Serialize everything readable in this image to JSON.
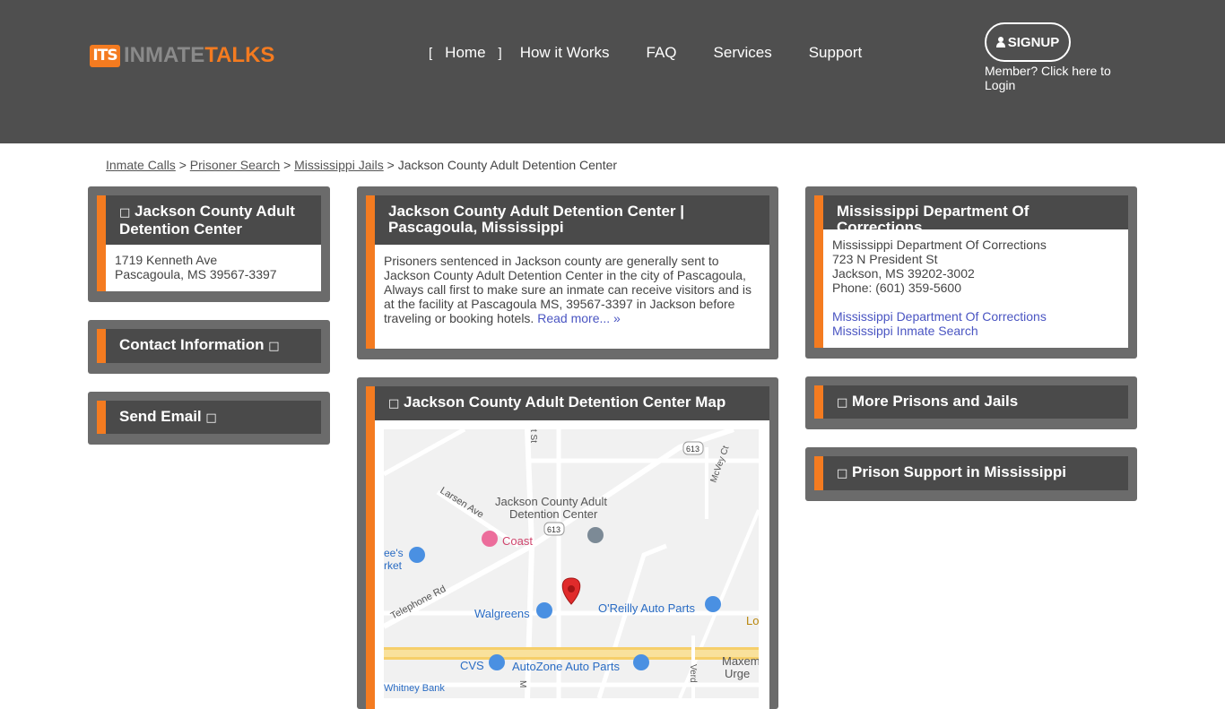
{
  "logo": {
    "badge": "ITS",
    "word1": "INMATE",
    "word2": "TALKS"
  },
  "nav": {
    "bracket_left": "[",
    "bracket_right": "]",
    "items": [
      "Home",
      "How it Works",
      "FAQ",
      "Services",
      "Support"
    ]
  },
  "header": {
    "signup_label": "SIGNUP",
    "member_text": "Member? Click here to Login"
  },
  "breadcrumb": {
    "items": [
      "Inmate Calls",
      "Prisoner Search",
      "Mississippi Jails"
    ],
    "separator": ">",
    "current": "Jackson County Adult Detention Center"
  },
  "left": {
    "facility_title": "Jackson County Adult Detention Center",
    "address_line1": "1719 Kenneth Ave",
    "address_line2": "Pascagoula, MS 39567-3397",
    "contact_title": "Contact Information",
    "email_title": "Send Email",
    "glyph": "□"
  },
  "center": {
    "title": "Jackson County Adult Detention Center | Pascagoula, Mississippi",
    "description": "Prisoners sentenced in Jackson county are generally sent to Jackson County Adult Detention Center in the city of Pascagoula, Always call first to make sure an inmate can receive visitors and is at the facility at Pascagoula MS, 39567-3397 in Jackson before traveling or booking hotels.",
    "read_more": "Read more... »",
    "map_title": "Jackson County Adult Detention Center Map"
  },
  "map": {
    "labels": {
      "facility_line1": "Jackson County Adult",
      "facility_line2": "Detention Center",
      "coast": "Coast",
      "larsen": "Larsen Ave",
      "telephone": "Telephone Rd",
      "walgreens": "Walgreens",
      "oreilly": "O'Reilly Auto Parts",
      "cvs": "CVS",
      "autozone": "AutoZone Auto Parts",
      "mcvey": "McVey Ct",
      "market1": "ee's",
      "market2": "rket",
      "route1": "613",
      "route2": "613",
      "maxem1": "Maxem",
      "maxem2": "Urge",
      "whitney": "Whitney Bank",
      "lo": "Lo",
      "verd": "Verd",
      "st": "t St",
      "m": "M"
    }
  },
  "right": {
    "doc_title": "Mississippi Department Of Corrections",
    "doc_name": "Mississippi Department Of Corrections",
    "doc_street": "723 N President St",
    "doc_city": "Jackson, MS 39202-3002",
    "doc_phone": "Phone: (601) 359-5600",
    "doc_link1": "Mississippi Department Of Corrections",
    "doc_link2": "Mississippi Inmate Search",
    "more_title": "More Prisons and Jails",
    "support_title": "Prison Support in Mississippi"
  },
  "colors": {
    "accent": "#f47b20",
    "header_bg": "#4f4f4f",
    "panel_bg": "#6b6b6b",
    "link": "#4a55c2"
  }
}
